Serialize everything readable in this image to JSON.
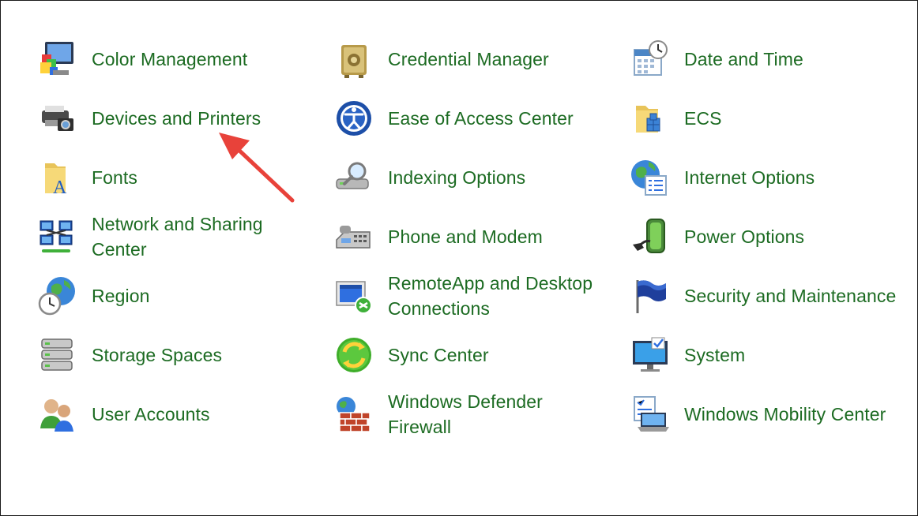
{
  "items": [
    {
      "label": "Color Management",
      "icon": "color-management-icon"
    },
    {
      "label": "Credential Manager",
      "icon": "credential-manager-icon"
    },
    {
      "label": "Date and Time",
      "icon": "date-time-icon"
    },
    {
      "label": "Devices and Printers",
      "icon": "devices-printers-icon"
    },
    {
      "label": "Ease of Access Center",
      "icon": "ease-of-access-icon"
    },
    {
      "label": "ECS",
      "icon": "ecs-folder-icon"
    },
    {
      "label": "Fonts",
      "icon": "fonts-folder-icon"
    },
    {
      "label": "Indexing Options",
      "icon": "indexing-options-icon"
    },
    {
      "label": "Internet Options",
      "icon": "internet-options-icon"
    },
    {
      "label": "Network and Sharing Center",
      "icon": "network-sharing-icon"
    },
    {
      "label": "Phone and Modem",
      "icon": "phone-modem-icon"
    },
    {
      "label": "Power Options",
      "icon": "power-options-icon"
    },
    {
      "label": "Region",
      "icon": "region-icon"
    },
    {
      "label": "RemoteApp and Desktop Connections",
      "icon": "remoteapp-icon"
    },
    {
      "label": "Security and Maintenance",
      "icon": "security-flag-icon"
    },
    {
      "label": "Storage Spaces",
      "icon": "storage-spaces-icon"
    },
    {
      "label": "Sync Center",
      "icon": "sync-center-icon"
    },
    {
      "label": "System",
      "icon": "system-monitor-icon"
    },
    {
      "label": "User Accounts",
      "icon": "user-accounts-icon"
    },
    {
      "label": "Windows Defender Firewall",
      "icon": "firewall-icon"
    },
    {
      "label": "Windows Mobility Center",
      "icon": "mobility-center-icon"
    }
  ],
  "annotation": {
    "arrow_color": "#e8423a",
    "points_to": "Devices and Printers"
  },
  "colors": {
    "link_text": "#1c6b22",
    "background": "#ffffff"
  }
}
